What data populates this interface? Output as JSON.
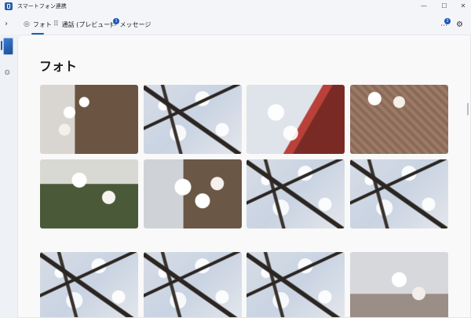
{
  "window": {
    "title": "スマートフォン連携",
    "controls": {
      "minimize": "—",
      "maximize": "☐",
      "close": "✕"
    }
  },
  "tabs": [
    {
      "label": "フォト",
      "icon": "photos-icon",
      "active": true
    },
    {
      "label": "通話 (プレビュー)",
      "icon": "dialpad-icon"
    },
    {
      "label": "メッセージ",
      "icon": "message-icon",
      "badge": "1"
    }
  ],
  "header": {
    "notification_badge": "2"
  },
  "page": {
    "title": "フォト"
  },
  "photos": [
    {
      "kind": "trunk"
    },
    {
      "kind": "sky"
    },
    {
      "kind": "roof"
    },
    {
      "kind": "tiles"
    },
    {
      "kind": "moss"
    },
    {
      "kind": "bloom"
    },
    {
      "kind": "sky"
    },
    {
      "kind": "sky"
    },
    {
      "kind": "sky"
    },
    {
      "kind": "sky"
    },
    {
      "kind": "sky"
    },
    {
      "kind": "street"
    }
  ],
  "colors": {
    "accent": "#1a5fb4",
    "badge": "#1d56b5"
  }
}
